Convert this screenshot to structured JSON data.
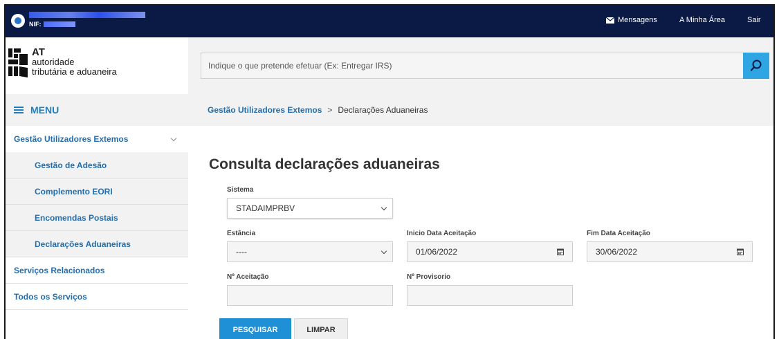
{
  "topbar": {
    "nif_label": "NIF:",
    "messages": "Mensagens",
    "my_area": "A Minha Área",
    "logout": "Sair"
  },
  "logo": {
    "at": "AT",
    "line1": "autoridade",
    "line2": "tributária e aduaneira"
  },
  "search": {
    "placeholder": "Indique o que pretende efetuar (Ex: Entregar IRS)"
  },
  "sidebar": {
    "menu_label": "MENU",
    "group": "Gestão Utilizadores Extemos",
    "sub_items": [
      {
        "label": "Gestão de Adesão"
      },
      {
        "label": "Complemento EORI"
      },
      {
        "label": "Encomendas Postais"
      },
      {
        "label": "Declarações Aduaneiras"
      }
    ],
    "items": [
      {
        "label": "Serviços Relacionados"
      },
      {
        "label": "Todos os Serviços"
      }
    ]
  },
  "breadcrumb": {
    "parent": "Gestão Utilizadores Extemos",
    "separator": ">",
    "current": "Declarações Aduaneiras"
  },
  "form": {
    "title": "Consulta declarações aduaneiras",
    "sistema_label": "Sistema",
    "sistema_value": "STADAIMPRBV",
    "estancia_label": "Estância",
    "estancia_value": "----",
    "inicio_label": "Inicio Data Aceitação",
    "inicio_value": "01/06/2022",
    "fim_label": "Fim Data Aceitação",
    "fim_value": "30/06/2022",
    "aceitacao_label": "Nº Aceitação",
    "aceitacao_value": "",
    "provisorio_label": "Nº Provisorio",
    "provisorio_value": "",
    "search_button": "PESQUISAR",
    "clear_button": "LIMPAR"
  },
  "colors": {
    "topbar": "#0b1a45",
    "accent": "#1f8fd6",
    "link": "#1f6fb2"
  }
}
